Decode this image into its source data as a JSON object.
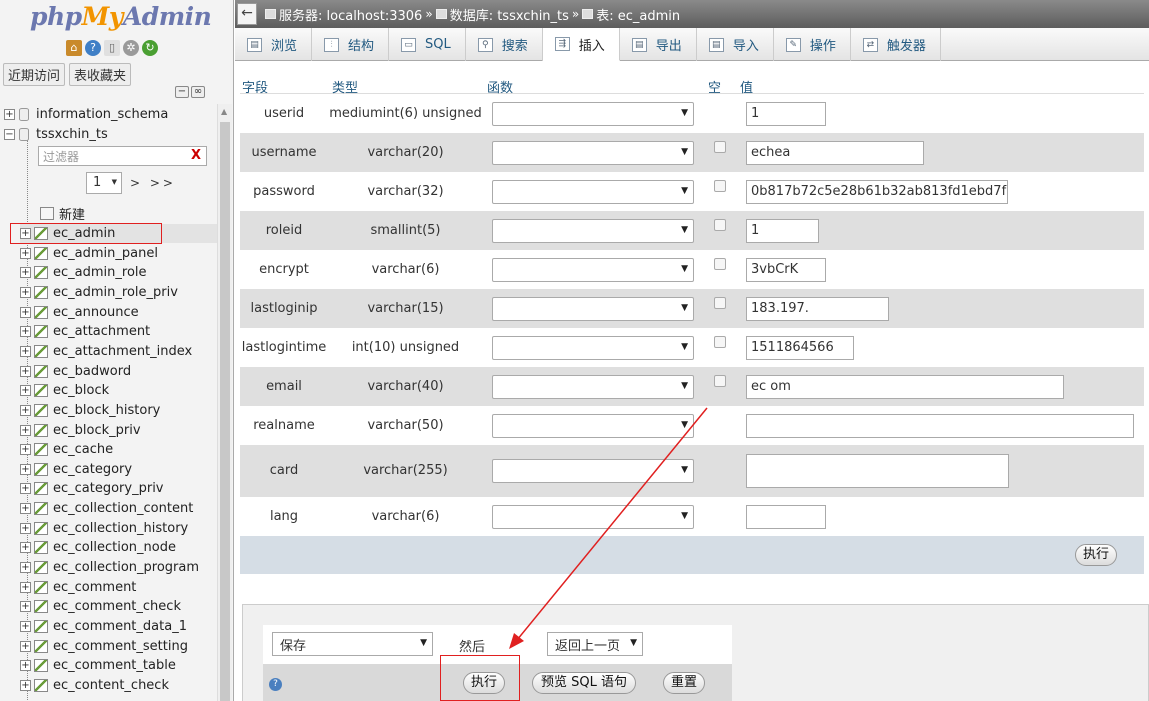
{
  "logo": {
    "part1": "php",
    "part2": "My",
    "part3": "Admin"
  },
  "nav_tabs": [
    "近期访问",
    "表收藏夹"
  ],
  "databases": [
    {
      "name": "information_schema",
      "expander": "+"
    },
    {
      "name": "tssxchin_ts",
      "expander": "−"
    }
  ],
  "filter": {
    "placeholder": "过滤器",
    "clear": "X"
  },
  "pager": {
    "page": "1",
    "next": "> >>"
  },
  "new_label": "新建",
  "tables": [
    "ec_admin",
    "ec_admin_panel",
    "ec_admin_role",
    "ec_admin_role_priv",
    "ec_announce",
    "ec_attachment",
    "ec_attachment_index",
    "ec_badword",
    "ec_block",
    "ec_block_history",
    "ec_block_priv",
    "ec_cache",
    "ec_category",
    "ec_category_priv",
    "ec_collection_content",
    "ec_collection_history",
    "ec_collection_node",
    "ec_collection_program",
    "ec_comment",
    "ec_comment_check",
    "ec_comment_data_1",
    "ec_comment_setting",
    "ec_comment_table",
    "ec_content_check"
  ],
  "active_table": "ec_admin",
  "breadcrumb": {
    "server": "服务器: localhost:3306",
    "database": "数据库: tssxchin_ts",
    "table": "表: ec_admin",
    "sep": "»"
  },
  "menu_tabs": [
    {
      "label": "浏览",
      "icon": "browse-icon"
    },
    {
      "label": "结构",
      "icon": "structure-icon"
    },
    {
      "label": "SQL",
      "icon": "sql-icon"
    },
    {
      "label": "搜索",
      "icon": "search-icon"
    },
    {
      "label": "插入",
      "icon": "insert-icon"
    },
    {
      "label": "导出",
      "icon": "export-icon"
    },
    {
      "label": "导入",
      "icon": "import-icon"
    },
    {
      "label": "操作",
      "icon": "operations-icon"
    },
    {
      "label": "触发器",
      "icon": "triggers-icon"
    }
  ],
  "active_tab": "插入",
  "grid": {
    "headers": {
      "field": "字段",
      "type": "类型",
      "function": "函数",
      "null": "空",
      "value": "值"
    },
    "rows": [
      {
        "field": "userid",
        "type": "mediumint(6) unsigned",
        "value": "1"
      },
      {
        "field": "username",
        "type": "varchar(20)",
        "value": "echea"
      },
      {
        "field": "password",
        "type": "varchar(32)",
        "value": "0b817b72c5e28b61b32ab813fd1ebd7f"
      },
      {
        "field": "roleid",
        "type": "smallint(5)",
        "value": "1"
      },
      {
        "field": "encrypt",
        "type": "varchar(6)",
        "value": "3vbCrK"
      },
      {
        "field": "lastloginip",
        "type": "varchar(15)",
        "value": "183.197."
      },
      {
        "field": "lastlogintime",
        "type": "int(10) unsigned",
        "value": "1511864566"
      },
      {
        "field": "email",
        "type": "varchar(40)",
        "value": "ec         om"
      },
      {
        "field": "realname",
        "type": "varchar(50)",
        "value": ""
      },
      {
        "field": "card",
        "type": "varchar(255)",
        "value": ""
      },
      {
        "field": "lang",
        "type": "varchar(6)",
        "value": ""
      }
    ],
    "execute": "执行"
  },
  "bottom": {
    "save_option": "保存",
    "then": "然后",
    "after_option": "返回上一页",
    "execute": "执行",
    "preview": "预览 SQL 语句",
    "reset": "重置"
  },
  "colors": {
    "highlight": "#e02020",
    "link": "#235a81",
    "row_alt": "#dfdfdf"
  }
}
